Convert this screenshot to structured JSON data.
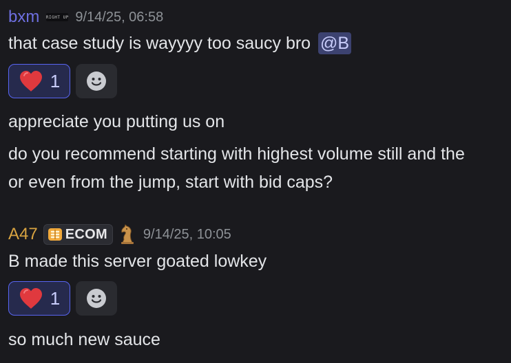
{
  "messages": [
    {
      "author": "bxm",
      "author_tag": "RIGHT UP",
      "timestamp": "9/14/25, 06:58",
      "text": "that case study is wayyyy too saucy bro",
      "mention": "@B",
      "reaction": {
        "emoji": "heart-emoji",
        "count": "1"
      }
    },
    {
      "lines": [
        "appreciate you putting us on",
        "do you recommend starting with highest volume still and the",
        "or even from the jump, start with bid caps?"
      ]
    },
    {
      "author": "A47",
      "guild_tag": "ECOM",
      "timestamp": "9/14/25, 10:05",
      "text": "B made this server goated lowkey",
      "reaction": {
        "emoji": "heart-emoji",
        "count": "1"
      }
    },
    {
      "text": "so much new sauce"
    }
  ],
  "colors": {
    "background": "#1a1a1e",
    "bxm_name": "#6e6fe0",
    "a47_name": "#d9a441",
    "mention_bg": "#3c4270",
    "reaction_border": "#5865f2",
    "heart": "#e0393e"
  },
  "icons": [
    "heart-icon",
    "add-reaction-icon",
    "guild-tag-icon",
    "chess-knight-icon"
  ]
}
